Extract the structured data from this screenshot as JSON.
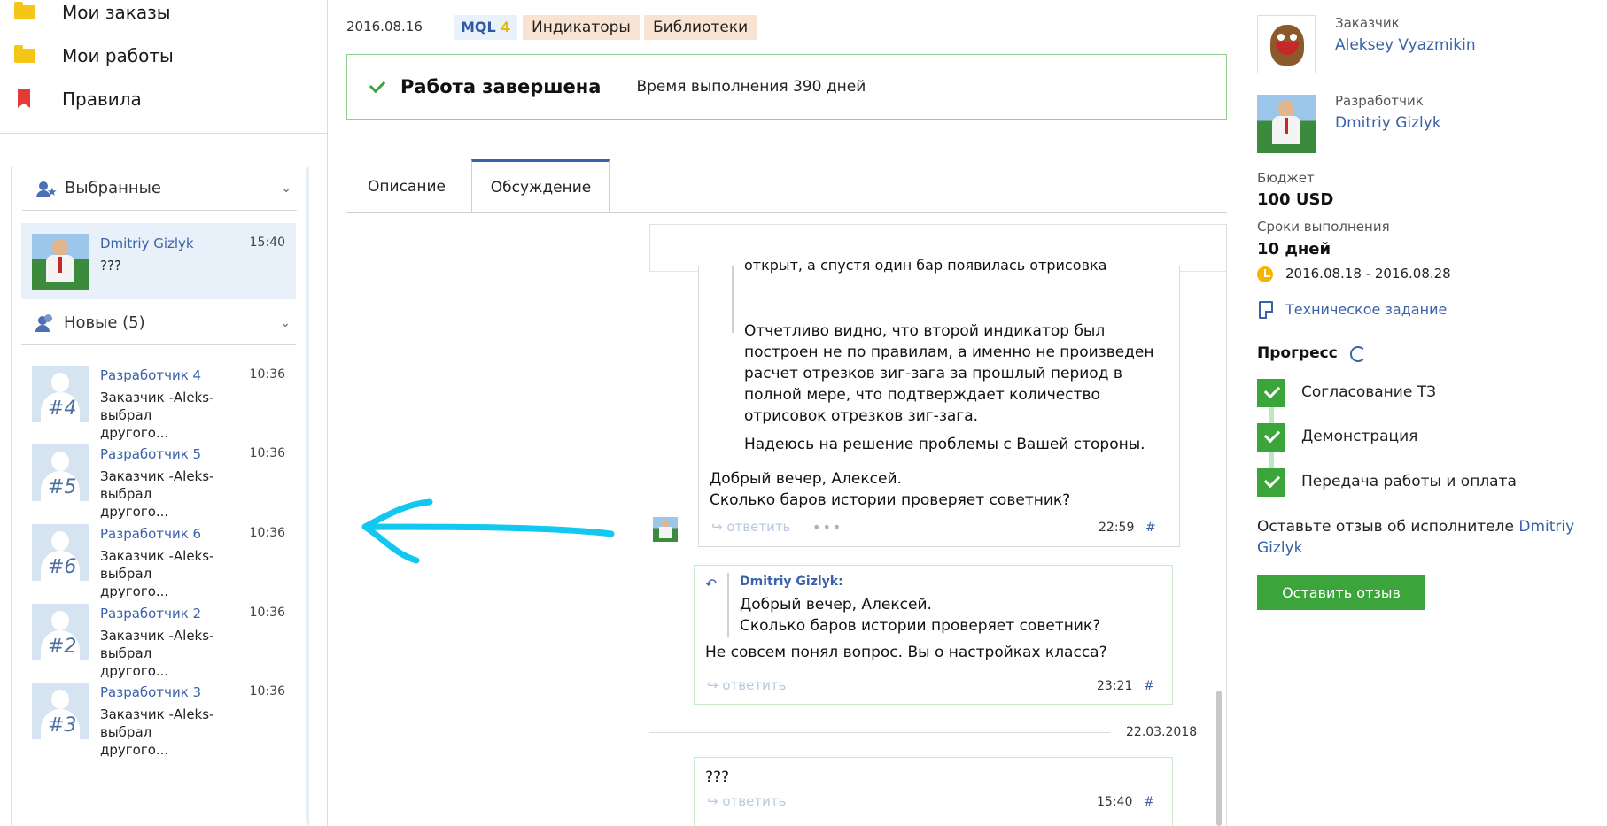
{
  "nav": {
    "items": [
      {
        "label": "Мои заказы",
        "icon": "folder-icon"
      },
      {
        "label": "Мои работы",
        "icon": "folder-icon"
      },
      {
        "label": "Правила",
        "icon": "bookmark-icon"
      }
    ]
  },
  "sidebar": {
    "favorites_title": "Выбранные",
    "favorites": [
      {
        "name": "Dmitriy Gizlyk",
        "time": "15:40",
        "text": "???"
      }
    ],
    "new_title": "Новые (5)",
    "new_items": [
      {
        "name": "Разработчик 4",
        "time": "10:36",
        "text": "Заказчик -Aleks- выбрал другого...",
        "num": "#4"
      },
      {
        "name": "Разработчик 5",
        "time": "10:36",
        "text": "Заказчик -Aleks- выбрал другого...",
        "num": "#5"
      },
      {
        "name": "Разработчик 6",
        "time": "10:36",
        "text": "Заказчик -Aleks- выбрал другого...",
        "num": "#6"
      },
      {
        "name": "Разработчик 2",
        "time": "10:36",
        "text": "Заказчик -Aleks- выбрал другого...",
        "num": "#2"
      },
      {
        "name": "Разработчик 3",
        "time": "10:36",
        "text": "Заказчик -Aleks- выбрал другого...",
        "num": "#3"
      }
    ]
  },
  "job": {
    "date": "2016.08.16",
    "tag_mql": "MQL",
    "tag_mql_num": "4",
    "tags": [
      "Индикаторы",
      "Библиотеки"
    ],
    "status": "Работа завершена",
    "duration": "Время выполнения 390 дней"
  },
  "tabs": [
    "Описание",
    "Обсуждение"
  ],
  "messages": {
    "m1": {
      "quote_cut": "открыт, а спустя один бар появилась отрисовка",
      "quote_p1": [
        "Отчетливо видно, что второй индикатор был",
        "построен не по правилам, а именно не произведен",
        "расчет отрезков зиг-зага за прошлый период в",
        "полной мере, что подтверждает количество",
        "отрисовок отрезков зиг-зага."
      ],
      "quote_p2": "Надеюсь на решение проблемы с Вашей стороны.",
      "text": [
        "Добрый вечер, Алексей.",
        "Сколько баров истории проверяет советник?"
      ],
      "reply": "ответить",
      "time": "22:59",
      "hash": "#"
    },
    "m2": {
      "quote_author": "Dmitriy Gizlyk",
      "quote": [
        "Добрый вечер, Алексей.",
        "Сколько баров истории проверяет советник?"
      ],
      "text": "Не совсем понял вопрос. Вы о настройках класса?",
      "reply": "ответить",
      "time": "23:21",
      "hash": "#"
    },
    "date_sep": "22.03.2018",
    "m3": {
      "text": "???",
      "reply": "ответить",
      "time": "15:40",
      "hash": "#"
    }
  },
  "right": {
    "customer_label": "Заказчик",
    "customer_name": "Aleksey Vyazmikin",
    "developer_label": "Разработчик",
    "developer_name": "Dmitriy Gizlyk",
    "budget_label": "Бюджет",
    "budget": "100 USD",
    "terms_label": "Сроки выполнения",
    "terms": "10 дней",
    "dates": "2016.08.18 - 2016.08.28",
    "spec_link": "Техническое задание",
    "progress_title": "Прогресс",
    "steps": [
      "Согласование ТЗ",
      "Демонстрация",
      "Передача работы и оплата"
    ],
    "review_text": "Оставьте отзыв об исполнителе",
    "review_name_1": "Dmitriy",
    "review_name_2": "Gizlyk",
    "review_button": "Оставить отзыв"
  },
  "colors": {
    "accent": "#3a62a8",
    "success": "#3ba53b",
    "arrow": "#12c8f0"
  }
}
